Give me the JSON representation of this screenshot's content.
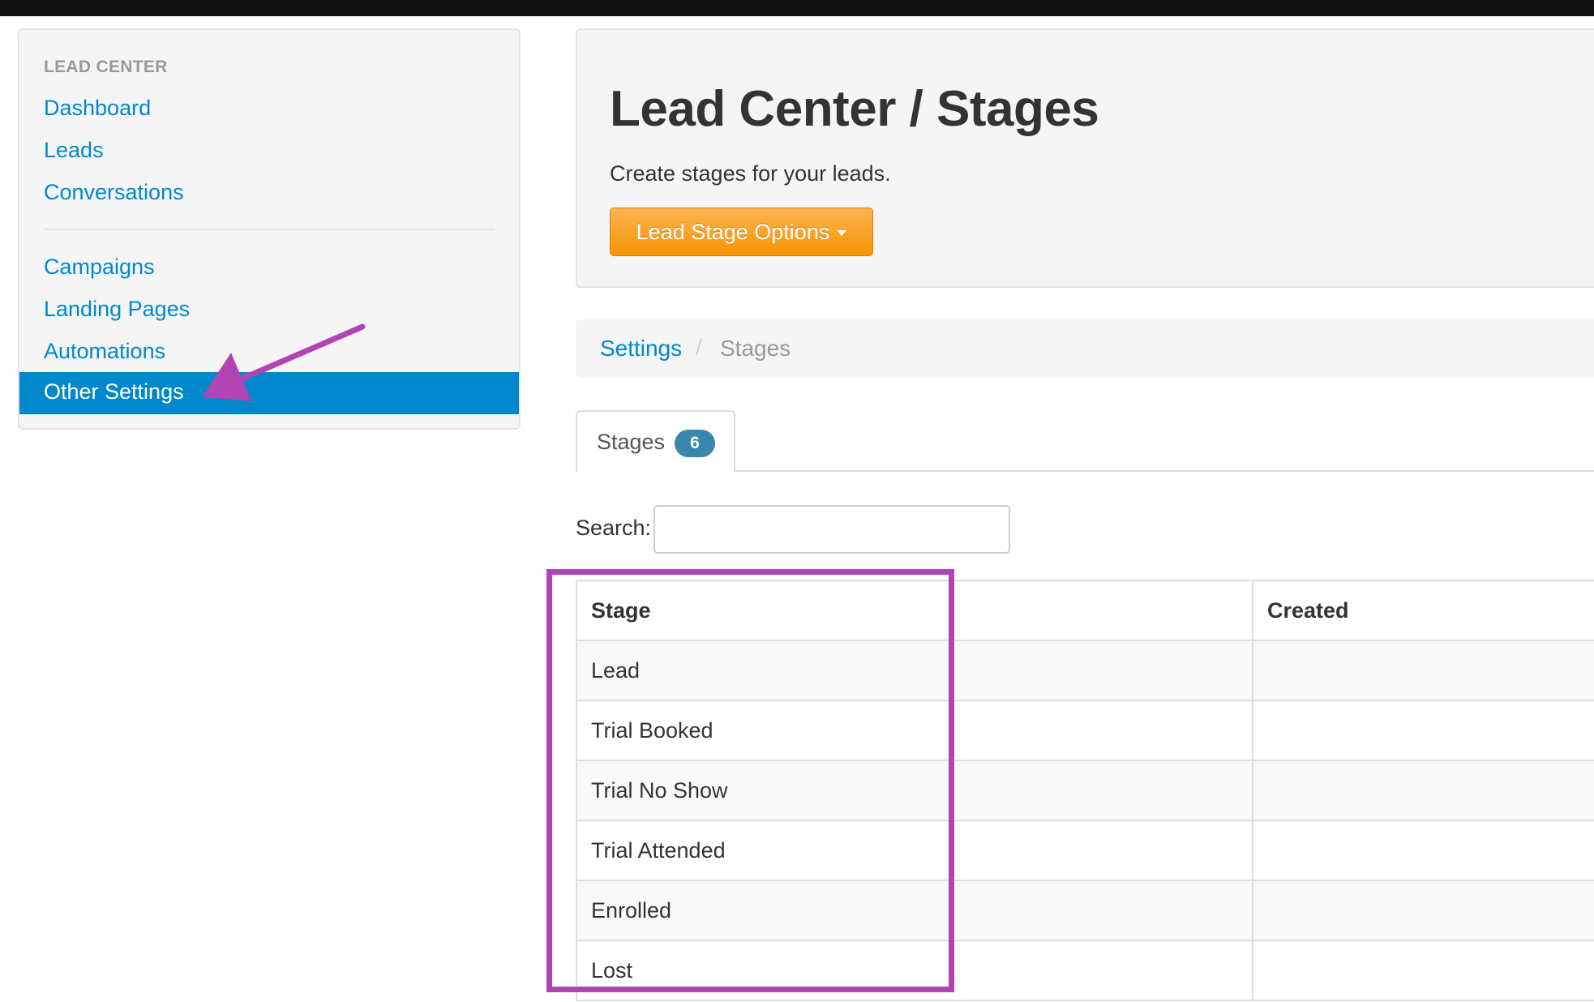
{
  "sidebar": {
    "header": "LEAD CENTER",
    "items": [
      {
        "label": "Dashboard"
      },
      {
        "label": "Leads"
      },
      {
        "label": "Conversations"
      },
      {
        "label": "Campaigns"
      },
      {
        "label": "Landing Pages"
      },
      {
        "label": "Automations"
      },
      {
        "label": "Other Settings"
      }
    ]
  },
  "hero": {
    "title": "Lead Center / Stages",
    "subtitle": "Create stages for your leads.",
    "options_button": "Lead Stage Options"
  },
  "breadcrumb": {
    "parent": "Settings",
    "separator": "/",
    "current": "Stages"
  },
  "tabs": [
    {
      "label": "Stages",
      "badge": "6"
    }
  ],
  "search": {
    "label": "Search:",
    "value": ""
  },
  "table": {
    "columns": [
      "Stage",
      "Created"
    ],
    "rows": [
      [
        "Lead",
        ""
      ],
      [
        "Trial Booked",
        ""
      ],
      [
        "Trial No Show",
        ""
      ],
      [
        "Trial Attended",
        ""
      ],
      [
        "Enrolled",
        ""
      ],
      [
        "Lost",
        ""
      ]
    ]
  },
  "annotations": {
    "highlight_color": "#b044b4",
    "arrow_color": "#b044b4"
  },
  "colors": {
    "link": "#0088cc",
    "active_nav": "#0088cc",
    "button_orange": "#f89406",
    "badge": "#3a87ad"
  }
}
